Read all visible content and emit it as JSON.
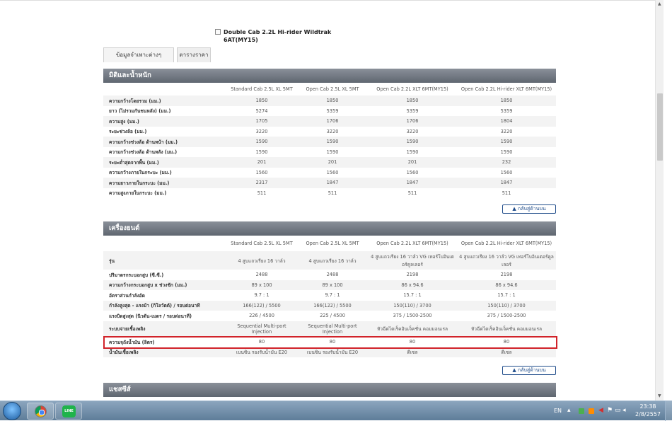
{
  "model": {
    "line1": "Double Cab 2.2L Hi-rider Wildtrak",
    "line2": "6AT(MY15)"
  },
  "tabs": [
    "ข้อมูลจำเพาะต่างๆ",
    "ตารางราคา"
  ],
  "dimensions": {
    "title": "มิติและน้ำหนัก",
    "columns": [
      "",
      "Standard Cab 2.5L XL 5MT",
      "Open Cab 2.5L XL 5MT",
      "Open Cab 2.2L XLT 6MT(MY15)",
      "Open Cab 2.2L Hi-rider XLT 6MT(MY15)"
    ],
    "rows": [
      [
        "ความกว้างโดยรวม (มม.)",
        "1850",
        "1850",
        "1850",
        "1850"
      ],
      [
        "ยาว (ไม่รวมกันชนหลัง) (มม.)",
        "5274",
        "5359",
        "5359",
        "5359"
      ],
      [
        "ความสูง (มม.)",
        "1705",
        "1706",
        "1706",
        "1804"
      ],
      [
        "ระยะช่วงล้อ (มม.)",
        "3220",
        "3220",
        "3220",
        "3220"
      ],
      [
        "ความกว้างช่วงล้อ ด้านหน้า (มม.)",
        "1590",
        "1590",
        "1590",
        "1590"
      ],
      [
        "ความกว้างช่วงล้อ ด้านหลัง (มม.)",
        "1590",
        "1590",
        "1590",
        "1590"
      ],
      [
        "ระยะต่ำสุดจากพื้น (มม.)",
        "201",
        "201",
        "201",
        "232"
      ],
      [
        "ความกว้างภายในกระบะ (มม.)",
        "1560",
        "1560",
        "1560",
        "1560"
      ],
      [
        "ความยาวภายในกระบะ (มม.)",
        "2317",
        "1847",
        "1847",
        "1847"
      ],
      [
        "ความสูงภายในกระบะ (มม.)",
        "511",
        "511",
        "511",
        "511"
      ]
    ],
    "back_top": "▲ กลับสู่ด้านบน"
  },
  "engine": {
    "title": "เครื่องยนต์",
    "columns": [
      "",
      "Standard Cab 2.5L XL 5MT",
      "Open Cab 2.5L XL 5MT",
      "Open Cab 2.2L XLT 6MT(MY15)",
      "Open Cab 2.2L Hi-rider XLT 6MT(MY15)"
    ],
    "rows": [
      [
        "รุ่น",
        "4 สูบแถวเรียง 16 วาล์ว",
        "4 สูบแถวเรียง 16 วาล์ว",
        "4 สูบแถวเรียง 16 วาล์ว VG เทอร์โบอินเตอร์คูลเลอร์",
        "4 สูบแถวเรียง 16 วาล์ว VG เทอร์โบอินเตอร์คูลเลอร์"
      ],
      [
        "ปริมาตรกระบอกสูบ (ซี.ซี.)",
        "2488",
        "2488",
        "2198",
        "2198"
      ],
      [
        "ความกว้างกระบอกสูบ x ช่วงชัก (มม.)",
        "89 x 100",
        "89 x 100",
        "86 x 94.6",
        "86 x 94.6"
      ],
      [
        "อัตราส่วนกำลังอัด",
        "9.7 : 1",
        "9.7 : 1",
        "15.7 : 1",
        "15.7 : 1"
      ],
      [
        "กำลังสูงสุด - แรงม้า (กิโลวัตต์) / รอบต่อนาที",
        "166(122) / 5500",
        "166(122) / 5500",
        "150(110) / 3700",
        "150(110) / 3700"
      ],
      [
        "แรงบิดสูงสุด (นิวตัน-เมตร / รอบต่อนาที)",
        "226 / 4500",
        "225 / 4500",
        "375 / 1500-2500",
        "375 / 1500-2500"
      ],
      [
        "ระบบจ่ายเชื้อเพลิง",
        "Sequential Multi-port Injection",
        "Sequential Multi-port Injection",
        "หัวฉีดไดเร็คอินเจ็คชั่น คอมมอนเรล",
        "หัวฉีดไดเร็คอินเจ็คชั่น คอมมอนเรล"
      ],
      [
        "ความจุถังน้ำมัน (ลิตร)",
        "80",
        "80",
        "80",
        "80"
      ],
      [
        "น้ำมันเชื้อเพลิง",
        "เบนซิน รองรับน้ำมัน E20",
        "เบนซิน รองรับน้ำมัน E20",
        "ดีเซล",
        "ดีเซล"
      ]
    ],
    "back_top": "▲ กลับสู่ด้านบน"
  },
  "chassis": {
    "title": "แชสซีส์"
  },
  "taskbar": {
    "lang": "EN",
    "time": "23:38",
    "date": "2/8/2557",
    "line_label": "LINE"
  }
}
